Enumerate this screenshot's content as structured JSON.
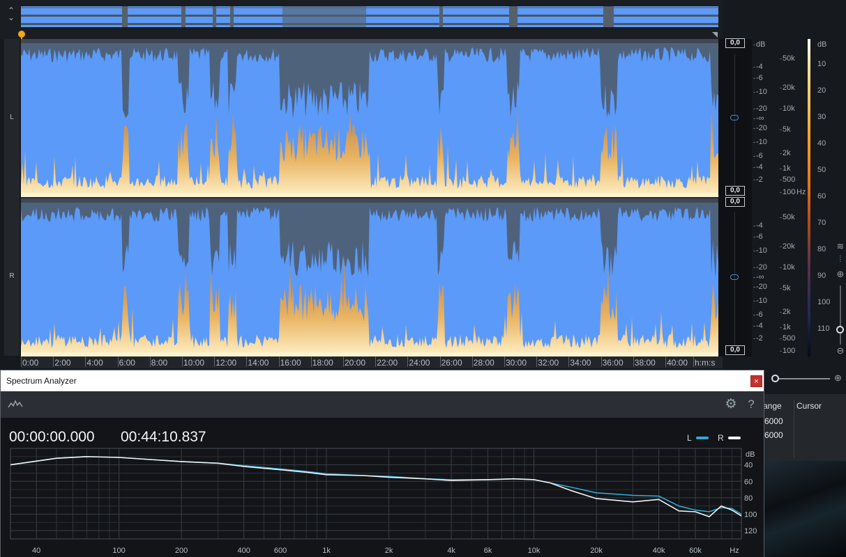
{
  "editor": {
    "channels": [
      {
        "label": "L",
        "peak_top": "0,0",
        "peak_bottom": "0,0"
      },
      {
        "label": "R",
        "peak_top": "0,0",
        "peak_bottom": "0,0"
      }
    ],
    "db_scale": {
      "unit": "dB",
      "ticks": [
        "-4",
        "-6",
        "-10",
        "-20",
        "-∞",
        "-20",
        "-10",
        "-6",
        "-4",
        "-2"
      ]
    },
    "hz_scale": {
      "unit": "Hz",
      "ticks": [
        "50k",
        "20k",
        "10k",
        "5k",
        "2k",
        "1k",
        "500",
        "100"
      ]
    },
    "colorbar": {
      "unit": "dB",
      "ticks": [
        "10",
        "20",
        "30",
        "40",
        "50",
        "60",
        "70",
        "80",
        "90",
        "100",
        "110"
      ]
    },
    "time_ruler": {
      "labels": [
        "0:00",
        "2:00",
        "4:00",
        "6:00",
        "8:00",
        "10:00",
        "12:00",
        "14:00",
        "16:00",
        "18:00",
        "20:00",
        "22:00",
        "24:00",
        "26:00",
        "28:00",
        "30:00",
        "32:00",
        "34:00",
        "36:00",
        "38:00",
        "40:00"
      ],
      "unit": "h:m:s"
    }
  },
  "right_panel": {
    "col1_header": "ange",
    "col2_header": "Cursor",
    "values": [
      "6000",
      "6000"
    ]
  },
  "spectrum_analyzer": {
    "title": "Spectrum Analyzer",
    "close_label": "×",
    "start_time": "00:00:00.000",
    "end_time": "00:44:10.837",
    "legend": [
      {
        "label": "L",
        "color": "#2fa8d8"
      },
      {
        "label": "R",
        "color": "#f2f2f2"
      }
    ]
  },
  "chart_data": {
    "type": "line",
    "xscale": "log",
    "xlabel": "Hz",
    "ylabel": "dB",
    "x_ticks": [
      "40",
      "100",
      "200",
      "400",
      "600",
      "1k",
      "2k",
      "4k",
      "6k",
      "10k",
      "20k",
      "40k",
      "60k",
      "Hz"
    ],
    "y_ticks": [
      "40",
      "60",
      "80",
      "100",
      "120"
    ],
    "ylim": [
      -130,
      -20
    ],
    "xlim": [
      30,
      100000
    ],
    "grid": true,
    "legend_position": "top-right",
    "series": [
      {
        "name": "L",
        "color": "#2fa8d8",
        "x": [
          30,
          50,
          70,
          100,
          150,
          200,
          300,
          400,
          600,
          800,
          1000,
          1500,
          2000,
          3000,
          4000,
          6000,
          8000,
          10000,
          12000,
          15000,
          20000,
          30000,
          40000,
          50000,
          60000,
          70000,
          80000,
          90000,
          100000
        ],
        "y": [
          -40,
          -32,
          -30,
          -31,
          -34,
          -36,
          -38,
          -41,
          -45,
          -48,
          -51,
          -53,
          -54,
          -57,
          -58,
          -58,
          -57,
          -58,
          -62,
          -67,
          -74,
          -77,
          -78,
          -90,
          -95,
          -97,
          -92,
          -93,
          -100
        ]
      },
      {
        "name": "R",
        "color": "#f2f2f2",
        "x": [
          30,
          50,
          70,
          100,
          150,
          200,
          300,
          400,
          600,
          800,
          1000,
          1500,
          2000,
          3000,
          4000,
          6000,
          8000,
          10000,
          12000,
          15000,
          20000,
          30000,
          40000,
          50000,
          60000,
          70000,
          80000,
          90000,
          100000
        ],
        "y": [
          -40,
          -32,
          -30,
          -31,
          -34,
          -36,
          -38,
          -42,
          -46,
          -49,
          -52,
          -53,
          -55,
          -57,
          -59,
          -58,
          -57,
          -58,
          -62,
          -71,
          -81,
          -85,
          -82,
          -96,
          -97,
          -103,
          -90,
          -95,
          -102
        ]
      }
    ]
  }
}
